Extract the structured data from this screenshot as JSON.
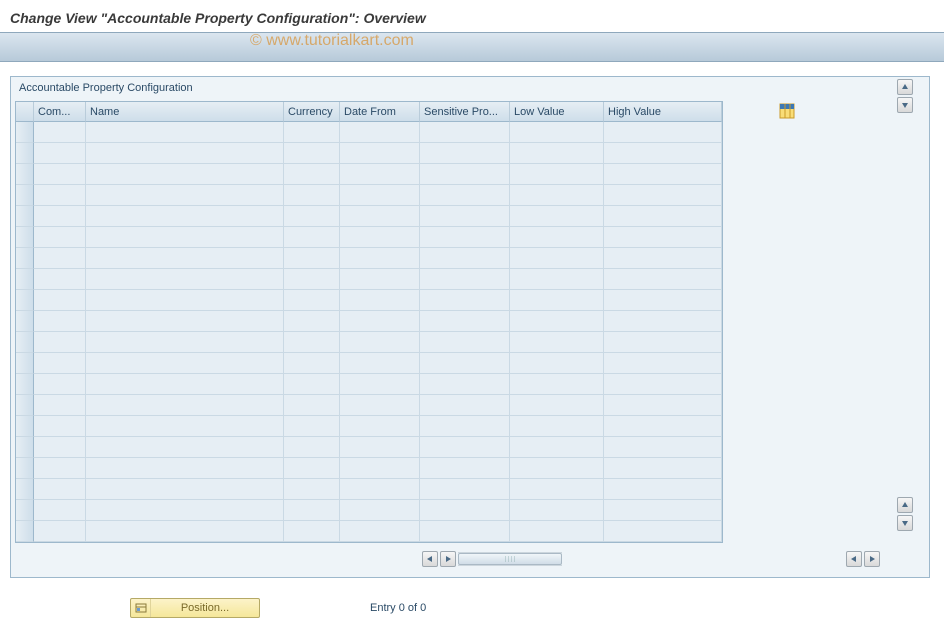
{
  "header": {
    "title": "Change View \"Accountable Property Configuration\": Overview"
  },
  "watermark": "© www.tutorialkart.com",
  "panel": {
    "title": "Accountable Property Configuration",
    "columns": [
      {
        "label": "Com..."
      },
      {
        "label": "Name"
      },
      {
        "label": "Currency"
      },
      {
        "label": "Date From"
      },
      {
        "label": "Sensitive Pro..."
      },
      {
        "label": "Low Value"
      },
      {
        "label": "High Value"
      }
    ],
    "rows": []
  },
  "footer": {
    "position_button": "Position...",
    "entry_status": "Entry 0 of 0"
  }
}
